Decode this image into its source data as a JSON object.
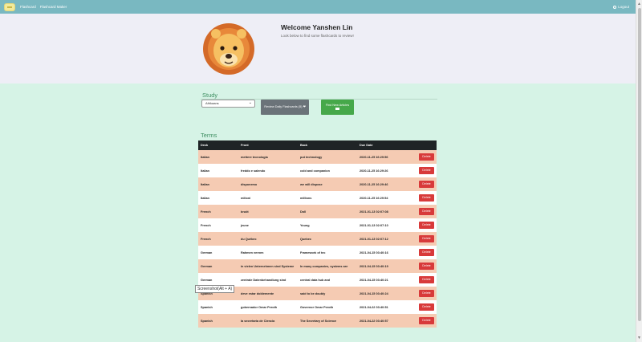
{
  "navbar": {
    "links": [
      "Flashcard",
      "Flashcard Maker"
    ],
    "logout": "Logout"
  },
  "hero": {
    "welcome": "Welcome Yanshen Lin",
    "subtitle": "Look below to find some flashcards to review!"
  },
  "study": {
    "title": "Study",
    "deck_selected": "Afrikaans",
    "review_button": "Review Daily Flashcards (5) ❤",
    "new_button": "Find New Articles"
  },
  "terms": {
    "title": "Terms",
    "columns": [
      "Deck",
      "Front",
      "Back",
      "Due Date",
      ""
    ],
    "delete_label": "Delete",
    "rows": [
      [
        "Italian",
        "mettere tecnologia",
        "put technology",
        "2020-11-25 16:29:56"
      ],
      [
        "Italian",
        "freddo e salendo",
        "cold and companion",
        "2020-11-25 16:29:26"
      ],
      [
        "Italian",
        "disponemo",
        "we will dispose",
        "2020-11-25 16:29:46"
      ],
      [
        "Italian",
        "milioni",
        "millions",
        "2020-11-25 16:29:54"
      ],
      [
        "French",
        "bruôt",
        "Doll",
        "2021-01-13 02:07:08"
      ],
      [
        "French",
        "jeune",
        "Young",
        "2021-01-13 02:07:10"
      ],
      [
        "French",
        "du Québec",
        "Quebec",
        "2021-01-13 02:07:12"
      ],
      [
        "German",
        "Rahmen vernen",
        "Framework of tec",
        "2021-04-15 03:40:16"
      ],
      [
        "German",
        "in vielen Unternehmen sind Systeme",
        "In many companies, systems are",
        "2021-04-15 03:40:19"
      ],
      [
        "German",
        "zentrale Datenbehandlung sind",
        "central data hub and",
        "2021-04-15 03:40:21"
      ],
      [
        "Spanish",
        "deve estar doblemente",
        "said to be doubly",
        "2021-04-15 03:40:24"
      ],
      [
        "Spanish",
        "gobernador Omar Peroth",
        "Governor Omar Peroth",
        "2021-04-22 03:40:51"
      ],
      [
        "Spanish",
        "la secretaria de Ciencia",
        "The Secretary of Science",
        "2021-04-22 03:40:57"
      ]
    ]
  },
  "tooltip": "Screenshot(Alt + A)",
  "colors": {
    "navbar": "#79b8c1",
    "hero_bg": "#eeeef6",
    "page_bg": "#d6f3e6",
    "table_header": "#1f2426",
    "row_salmon": "#f5cbb3",
    "delete": "#d83a3a",
    "review_btn": "#6b7379",
    "new_btn": "#46a84a",
    "section_title": "#3f8f62"
  },
  "icons": [
    "flashcard-logo-icon",
    "power-icon",
    "lion-avatar-icon",
    "heart-icon",
    "plus-icon"
  ]
}
